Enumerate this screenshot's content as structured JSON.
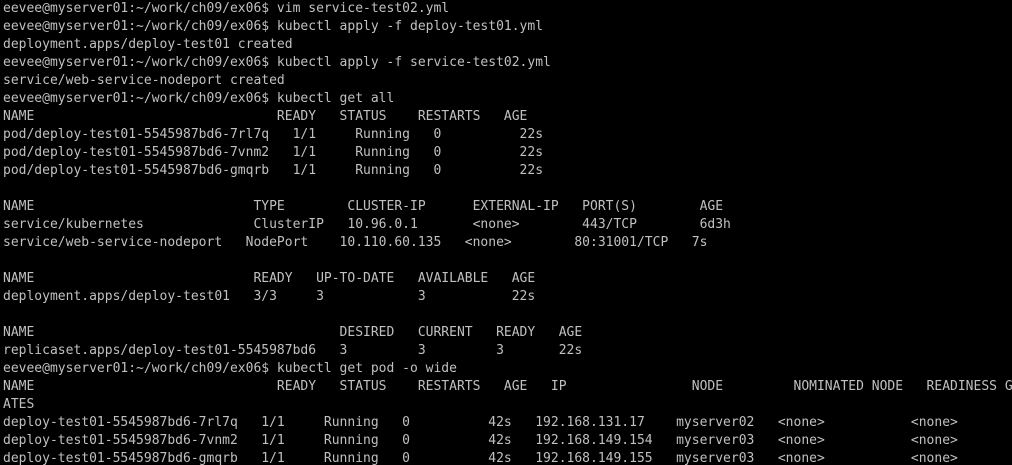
{
  "terminal": {
    "lines": [
      "eevee@myserver01:~/work/ch09/ex06$ vim service-test02.yml",
      "eevee@myserver01:~/work/ch09/ex06$ kubectl apply -f deploy-test01.yml",
      "deployment.apps/deploy-test01 created",
      "eevee@myserver01:~/work/ch09/ex06$ kubectl apply -f service-test02.yml",
      "service/web-service-nodeport created",
      "eevee@myserver01:~/work/ch09/ex06$ kubectl get all",
      "NAME                               READY   STATUS    RESTARTS   AGE",
      "pod/deploy-test01-5545987bd6-7rl7q   1/1     Running   0          22s",
      "pod/deploy-test01-5545987bd6-7vnm2   1/1     Running   0          22s",
      "pod/deploy-test01-5545987bd6-gmqrb   1/1     Running   0          22s",
      "",
      "NAME                            TYPE        CLUSTER-IP      EXTERNAL-IP   PORT(S)        AGE",
      "service/kubernetes              ClusterIP   10.96.0.1       <none>        443/TCP        6d3h",
      "service/web-service-nodeport   NodePort    10.110.60.135   <none>        80:31001/TCP   7s",
      "",
      "NAME                            READY   UP-TO-DATE   AVAILABLE   AGE",
      "deployment.apps/deploy-test01   3/3     3            3           22s",
      "",
      "NAME                                       DESIRED   CURRENT   READY   AGE",
      "replicaset.apps/deploy-test01-5545987bd6   3         3         3       22s",
      "eevee@myserver01:~/work/ch09/ex06$ kubectl get pod -o wide",
      "NAME                               READY   STATUS    RESTARTS   AGE   IP                NODE         NOMINATED NODE   READINESS G",
      "ATES",
      "deploy-test01-5545987bd6-7rl7q   1/1     Running   0          42s   192.168.131.17    myserver02   <none>           <none>",
      "deploy-test01-5545987bd6-7vnm2   1/1     Running   0          42s   192.168.149.154   myserver03   <none>           <none>",
      "deploy-test01-5545987bd6-gmqrb   1/1     Running   0          42s   192.168.149.155   myserver03   <none>           <none>"
    ]
  }
}
